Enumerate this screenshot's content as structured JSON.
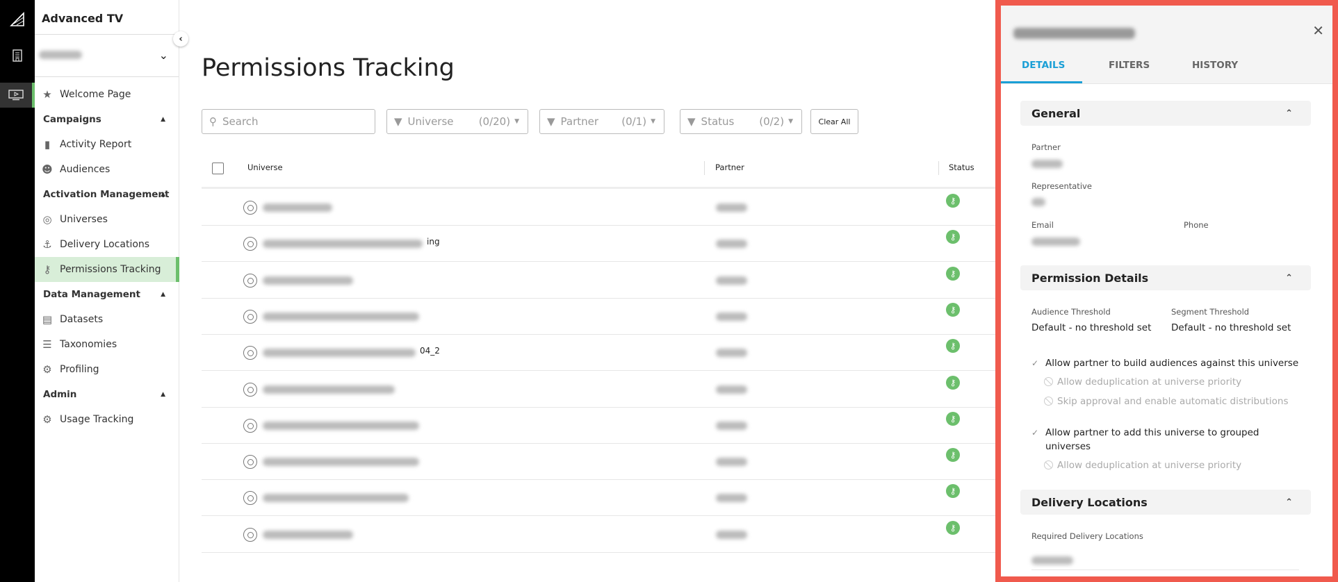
{
  "app": {
    "title": "Advanced TV"
  },
  "colors": {
    "accent": "#6cbf6c",
    "tab_active": "#1a9fd6",
    "highlight_border": "#f05a4d"
  },
  "sidebar": {
    "items": [
      {
        "label": "Welcome Page",
        "type": "item",
        "icon": "star-icon"
      },
      {
        "label": "Campaigns",
        "type": "section"
      },
      {
        "label": "Activity Report",
        "type": "item",
        "icon": "bar-chart-icon"
      },
      {
        "label": "Audiences",
        "type": "item",
        "icon": "people-icon"
      },
      {
        "label": "Activation Management",
        "type": "section"
      },
      {
        "label": "Universes",
        "type": "item",
        "icon": "universe-icon"
      },
      {
        "label": "Delivery Locations",
        "type": "item",
        "icon": "anchor-icon"
      },
      {
        "label": "Permissions Tracking",
        "type": "item",
        "icon": "key-icon",
        "selected": true
      },
      {
        "label": "Data Management",
        "type": "section"
      },
      {
        "label": "Datasets",
        "type": "item",
        "icon": "database-icon"
      },
      {
        "label": "Taxonomies",
        "type": "item",
        "icon": "taxonomy-icon"
      },
      {
        "label": "Profiling",
        "type": "item",
        "icon": "gear-icon"
      },
      {
        "label": "Admin",
        "type": "section"
      },
      {
        "label": "Usage Tracking",
        "type": "item",
        "icon": "gear-icon"
      }
    ]
  },
  "main": {
    "title": "Permissions Tracking",
    "search": {
      "placeholder": "Search"
    },
    "filters": [
      {
        "label": "Universe",
        "count": "(0/20)"
      },
      {
        "label": "Partner",
        "count": "(0/1)"
      },
      {
        "label": "Status",
        "count": "(0/2)"
      }
    ],
    "clear_all": "Clear All",
    "table": {
      "columns": [
        "Universe",
        "Partner",
        "Status"
      ],
      "rows": [
        {
          "tail": ""
        },
        {
          "tail": "ing"
        },
        {
          "tail": ""
        },
        {
          "tail": ""
        },
        {
          "tail": "04_2"
        },
        {
          "tail": ""
        },
        {
          "tail": ""
        },
        {
          "tail": ""
        },
        {
          "tail": ""
        },
        {
          "tail": ""
        }
      ]
    }
  },
  "panel": {
    "tabs": [
      "DETAILS",
      "FILTERS",
      "HISTORY"
    ],
    "general": {
      "title": "General",
      "partner_label": "Partner",
      "representative_label": "Representative",
      "email_label": "Email",
      "phone_label": "Phone"
    },
    "permission": {
      "title": "Permission Details",
      "audience_threshold_label": "Audience Threshold",
      "audience_threshold_value": "Default - no threshold set",
      "segment_threshold_label": "Segment Threshold",
      "segment_threshold_value": "Default - no threshold set",
      "allow_build": "Allow partner to build audiences against this universe",
      "dedup_1": "Allow deduplication at universe priority",
      "skip_approval": "Skip approval and enable automatic distributions",
      "allow_grouped": "Allow partner to add this universe to grouped universes",
      "dedup_2": "Allow deduplication at universe priority"
    },
    "delivery": {
      "title": "Delivery Locations",
      "required_label": "Required Delivery Locations"
    }
  }
}
